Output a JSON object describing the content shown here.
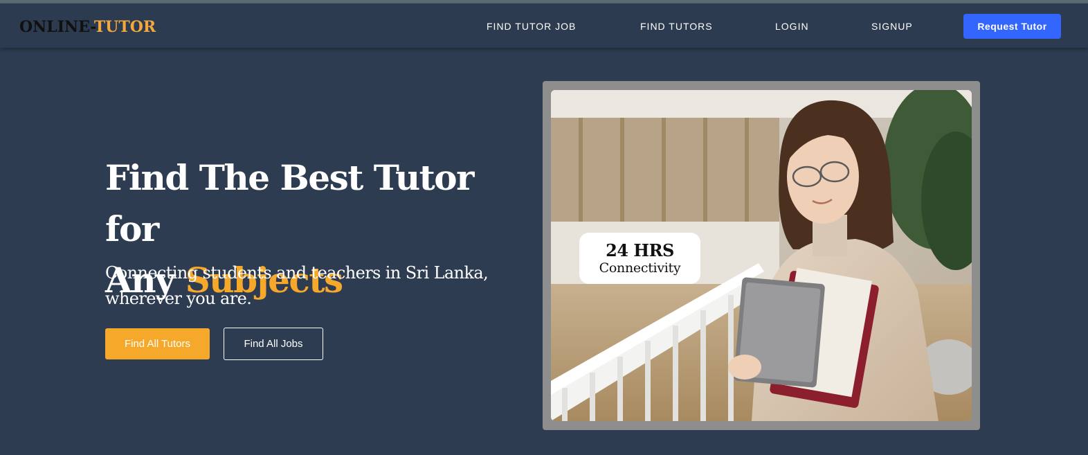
{
  "brand": {
    "logo_part1": "ONLINE-",
    "logo_part2": "TUTOR"
  },
  "nav": {
    "items": [
      {
        "label": "FIND TUTOR JOB"
      },
      {
        "label": "FIND TUTORS"
      },
      {
        "label": "LOGIN"
      },
      {
        "label": "SIGNUP"
      }
    ],
    "cta_label": "Request Tutor"
  },
  "hero": {
    "title_line1": "Find The Best Tutor for",
    "title_line2_plain": "Any ",
    "title_line2_accent": "Subjects",
    "subtitle": "Connecting students and teachers in Sri Lanka, wherever you are.",
    "primary_button": "Find All Tutors",
    "secondary_button": "Find All Jobs"
  },
  "image_badge": {
    "line1": "24 HRS",
    "line2": "Connectivity"
  },
  "colors": {
    "background": "#2d3c50",
    "accent": "#f6a82a",
    "cta_blue": "#3366ff"
  }
}
